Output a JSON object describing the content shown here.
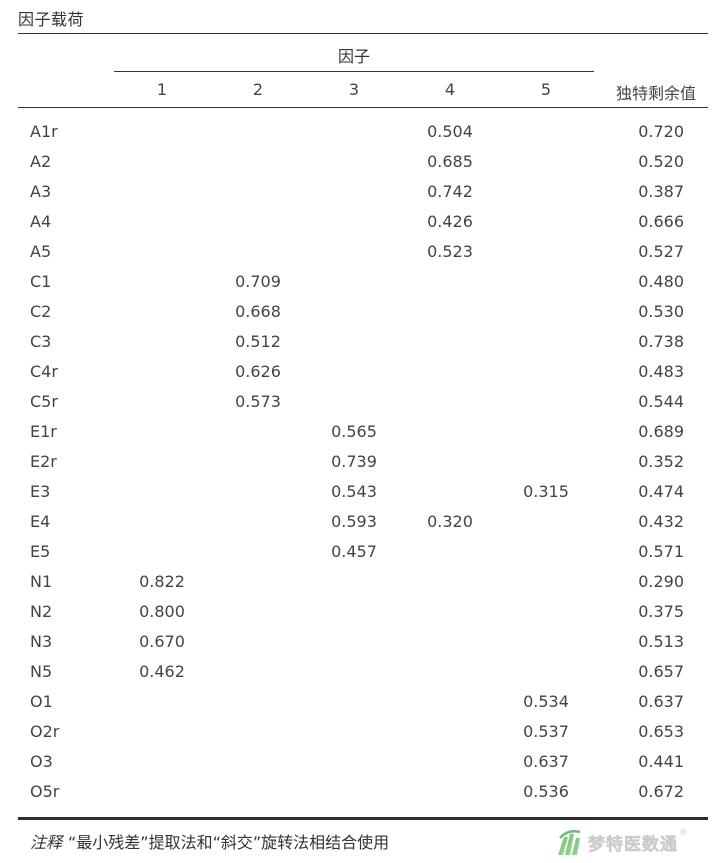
{
  "table": {
    "title": "因子载荷",
    "group_header": "因子",
    "factor_columns": [
      "1",
      "2",
      "3",
      "4",
      "5"
    ],
    "uniqueness_header": "独特剩余值",
    "rows": [
      {
        "item": "A1r",
        "loadings": [
          "",
          "",
          "",
          "0.504",
          ""
        ],
        "uniqueness": "0.720"
      },
      {
        "item": "A2",
        "loadings": [
          "",
          "",
          "",
          "0.685",
          ""
        ],
        "uniqueness": "0.520"
      },
      {
        "item": "A3",
        "loadings": [
          "",
          "",
          "",
          "0.742",
          ""
        ],
        "uniqueness": "0.387"
      },
      {
        "item": "A4",
        "loadings": [
          "",
          "",
          "",
          "0.426",
          ""
        ],
        "uniqueness": "0.666"
      },
      {
        "item": "A5",
        "loadings": [
          "",
          "",
          "",
          "0.523",
          ""
        ],
        "uniqueness": "0.527"
      },
      {
        "item": "C1",
        "loadings": [
          "",
          "0.709",
          "",
          "",
          ""
        ],
        "uniqueness": "0.480"
      },
      {
        "item": "C2",
        "loadings": [
          "",
          "0.668",
          "",
          "",
          ""
        ],
        "uniqueness": "0.530"
      },
      {
        "item": "C3",
        "loadings": [
          "",
          "0.512",
          "",
          "",
          ""
        ],
        "uniqueness": "0.738"
      },
      {
        "item": "C4r",
        "loadings": [
          "",
          "0.626",
          "",
          "",
          ""
        ],
        "uniqueness": "0.483"
      },
      {
        "item": "C5r",
        "loadings": [
          "",
          "0.573",
          "",
          "",
          ""
        ],
        "uniqueness": "0.544"
      },
      {
        "item": "E1r",
        "loadings": [
          "",
          "",
          "0.565",
          "",
          ""
        ],
        "uniqueness": "0.689"
      },
      {
        "item": "E2r",
        "loadings": [
          "",
          "",
          "0.739",
          "",
          ""
        ],
        "uniqueness": "0.352"
      },
      {
        "item": "E3",
        "loadings": [
          "",
          "",
          "0.543",
          "",
          "0.315"
        ],
        "uniqueness": "0.474"
      },
      {
        "item": "E4",
        "loadings": [
          "",
          "",
          "0.593",
          "0.320",
          ""
        ],
        "uniqueness": "0.432"
      },
      {
        "item": "E5",
        "loadings": [
          "",
          "",
          "0.457",
          "",
          ""
        ],
        "uniqueness": "0.571"
      },
      {
        "item": "N1",
        "loadings": [
          "0.822",
          "",
          "",
          "",
          ""
        ],
        "uniqueness": "0.290"
      },
      {
        "item": "N2",
        "loadings": [
          "0.800",
          "",
          "",
          "",
          ""
        ],
        "uniqueness": "0.375"
      },
      {
        "item": "N3",
        "loadings": [
          "0.670",
          "",
          "",
          "",
          ""
        ],
        "uniqueness": "0.513"
      },
      {
        "item": "N5",
        "loadings": [
          "0.462",
          "",
          "",
          "",
          ""
        ],
        "uniqueness": "0.657"
      },
      {
        "item": "O1",
        "loadings": [
          "",
          "",
          "",
          "",
          "0.534"
        ],
        "uniqueness": "0.637"
      },
      {
        "item": "O2r",
        "loadings": [
          "",
          "",
          "",
          "",
          "0.537"
        ],
        "uniqueness": "0.653"
      },
      {
        "item": "O3",
        "loadings": [
          "",
          "",
          "",
          "",
          "0.637"
        ],
        "uniqueness": "0.441"
      },
      {
        "item": "O5r",
        "loadings": [
          "",
          "",
          "",
          "",
          "0.536"
        ],
        "uniqueness": "0.672"
      }
    ],
    "note_label": "注释",
    "note_text": "“最小残差”提取法和“斜交”旋转法相结合使用"
  },
  "watermark": {
    "text": "梦特医数通",
    "registered_mark": "®",
    "logo_colors": [
      "#3aa34a",
      "#8cd17a"
    ]
  }
}
